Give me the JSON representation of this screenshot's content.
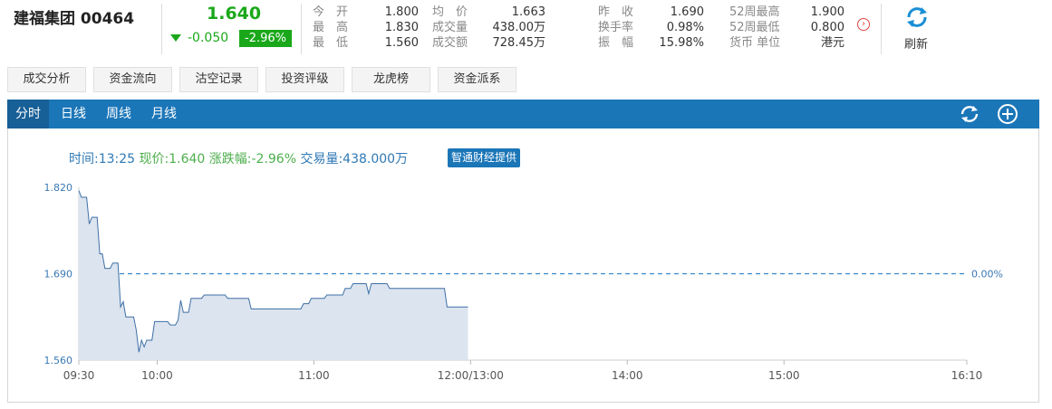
{
  "header": {
    "stock_name": "建福集团 00464",
    "price": "1.640",
    "change": "-0.050",
    "change_pct": "-2.96%",
    "refresh_label": "刷新",
    "quote_rows": [
      [
        {
          "label": "今　开",
          "value": "1.800"
        },
        {
          "label": "均　价",
          "value": "1.663"
        },
        {
          "label": "昨　收",
          "value": "1.690"
        },
        {
          "label": "52周最高",
          "value": "1.900"
        }
      ],
      [
        {
          "label": "最　高",
          "value": "1.830"
        },
        {
          "label": "成交量",
          "value": "438.00万"
        },
        {
          "label": "换手率",
          "value": "0.98%"
        },
        {
          "label": "52周最低",
          "value": "0.800"
        }
      ],
      [
        {
          "label": "最　低",
          "value": "1.560"
        },
        {
          "label": "成交额",
          "value": "728.45万"
        },
        {
          "label": "振　幅",
          "value": "15.98%"
        },
        {
          "label": "货币 单位",
          "value": "港元"
        }
      ]
    ]
  },
  "tabs": [
    "成交分析",
    "资金流向",
    "沽空记录",
    "投资评级",
    "龙虎榜",
    "资金派系"
  ],
  "periods": [
    "分时",
    "日线",
    "周线",
    "月线"
  ],
  "active_period": "分时",
  "info": {
    "time": "时间:13:25",
    "price": "现价:1.640",
    "change": "涨跌幅:-2.96%",
    "volume": "交易量:438.000万",
    "provider": "智通财经提供"
  },
  "colors": {
    "accent": "#1b76b8",
    "down": "#1aa81a",
    "line": "#3f6fa6",
    "area": "#dbe4ef"
  },
  "chart_data": {
    "type": "area",
    "y_ticks": [
      "1.820",
      "1.690",
      "1.560"
    ],
    "ylim": [
      1.56,
      1.82
    ],
    "reference": {
      "value": 1.69,
      "label": "0.00%"
    },
    "x_ticks": [
      "09:30",
      "10:00",
      "11:00",
      "12:00/13:00",
      "14:00",
      "15:00",
      "16:10"
    ],
    "x_tick_minutes": [
      0,
      30,
      90,
      150,
      210,
      270,
      340
    ],
    "points": [
      [
        0,
        1.815
      ],
      [
        1,
        1.805
      ],
      [
        3,
        1.805
      ],
      [
        4,
        1.765
      ],
      [
        5,
        1.775
      ],
      [
        7,
        1.775
      ],
      [
        8,
        1.72
      ],
      [
        9,
        1.72
      ],
      [
        10,
        1.698
      ],
      [
        12,
        1.698
      ],
      [
        13,
        1.706
      ],
      [
        15,
        1.706
      ],
      [
        16,
        1.64
      ],
      [
        17,
        1.648
      ],
      [
        18,
        1.625
      ],
      [
        21,
        1.625
      ],
      [
        22,
        1.605
      ],
      [
        23,
        1.572
      ],
      [
        24,
        1.59
      ],
      [
        25,
        1.58
      ],
      [
        26,
        1.59
      ],
      [
        28,
        1.59
      ],
      [
        29,
        1.618
      ],
      [
        34,
        1.618
      ],
      [
        35,
        1.613
      ],
      [
        37,
        1.613
      ],
      [
        38,
        1.62
      ],
      [
        39,
        1.65
      ],
      [
        40,
        1.632
      ],
      [
        42,
        1.632
      ],
      [
        43,
        1.653
      ],
      [
        47,
        1.653
      ],
      [
        48,
        1.658
      ],
      [
        56,
        1.658
      ],
      [
        57,
        1.653
      ],
      [
        65,
        1.653
      ],
      [
        66,
        1.637
      ],
      [
        85,
        1.637
      ],
      [
        86,
        1.645
      ],
      [
        88,
        1.645
      ],
      [
        89,
        1.653
      ],
      [
        94,
        1.653
      ],
      [
        95,
        1.658
      ],
      [
        101,
        1.658
      ],
      [
        102,
        1.668
      ],
      [
        104,
        1.668
      ],
      [
        105,
        1.675
      ],
      [
        110,
        1.675
      ],
      [
        111,
        1.66
      ],
      [
        112,
        1.675
      ],
      [
        118,
        1.675
      ],
      [
        119,
        1.668
      ],
      [
        140,
        1.668
      ],
      [
        141,
        1.64
      ],
      [
        149,
        1.64
      ]
    ]
  }
}
